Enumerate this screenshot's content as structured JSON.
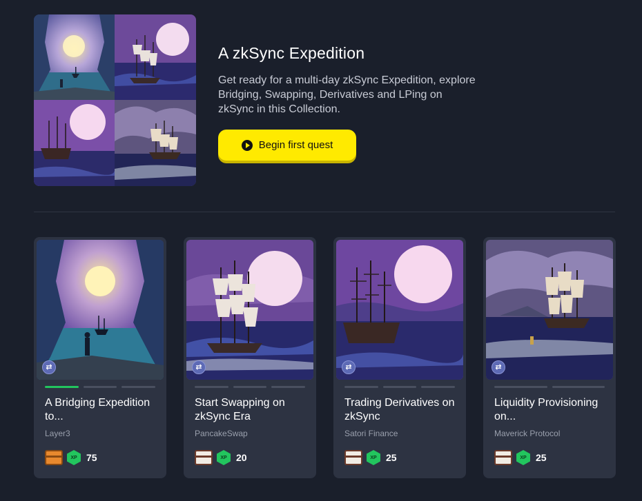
{
  "hero": {
    "title": "A zkSync Expedition",
    "description": "Get ready for a multi-day zkSync Expedition, explore Bridging, Swapping, Derivatives and LPing on zkSync in this Collection.",
    "button_label": "Begin first quest"
  },
  "cards": [
    {
      "title": "A Bridging Expedition to...",
      "project": "Layer3",
      "xp": "75",
      "progress_done": 1,
      "progress_total": 3,
      "chest": "gold"
    },
    {
      "title": "Start Swapping on zkSync Era",
      "project": "PancakeSwap",
      "xp": "20",
      "progress_done": 0,
      "progress_total": 3,
      "chest": "plain"
    },
    {
      "title": "Trading Derivatives on zkSync",
      "project": "Satori Finance",
      "xp": "25",
      "progress_done": 0,
      "progress_total": 3,
      "chest": "plain"
    },
    {
      "title": "Liquidity Provisioning on...",
      "project": "Maverick Protocol",
      "xp": "25",
      "progress_done": 0,
      "progress_total": 2,
      "chest": "plain"
    }
  ],
  "icons": {
    "bridge": "bridge-arrows-icon",
    "chest": "treasure-chest-icon",
    "xp": "xp-badge-icon",
    "play": "play-icon"
  },
  "colors": {
    "background": "#1a1f2b",
    "card": "#2d3342",
    "accent": "#ffea00",
    "progress": "#22c55e"
  }
}
